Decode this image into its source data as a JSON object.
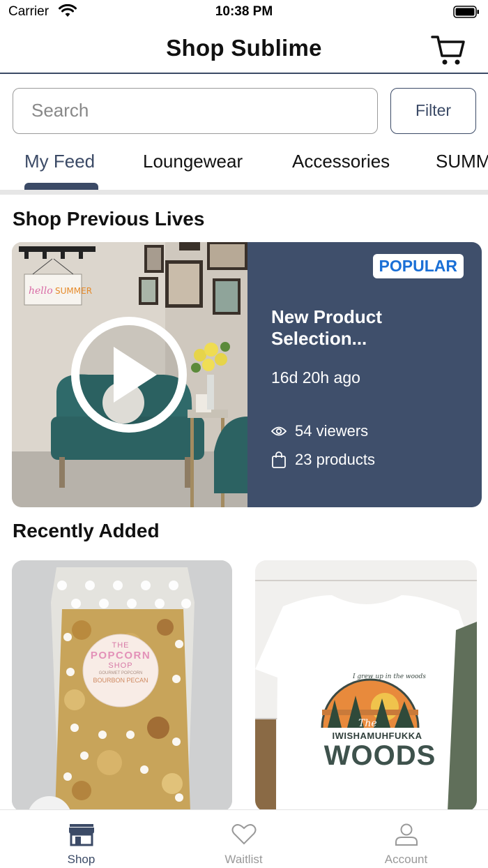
{
  "status_bar": {
    "carrier": "Carrier",
    "time": "10:38 PM"
  },
  "header": {
    "title": "Shop Sublime"
  },
  "search": {
    "placeholder": "Search",
    "filter_label": "Filter"
  },
  "tabs": [
    {
      "label": "My Feed",
      "active": true
    },
    {
      "label": "Loungewear",
      "active": false
    },
    {
      "label": "Accessories",
      "active": false
    },
    {
      "label": "SUMM",
      "active": false
    }
  ],
  "sections": {
    "previous_lives": "Shop Previous Lives",
    "recently_added": "Recently Added"
  },
  "live": {
    "badge": "POPULAR",
    "title": "New Product Selection...",
    "time_ago": "16d 20h ago",
    "viewers": "54 viewers",
    "products": "23 products"
  },
  "products": [
    {
      "label": "THE POPCORN SHOP",
      "sub": "BOURBON PECAN",
      "brand_top": "THE",
      "brand_mid": "POPCORN",
      "brand_bot": "SHOP",
      "tag": "GOURMET POPCORN"
    },
    {
      "label_top": "I grew up in the woods",
      "label_the": "The",
      "label_name": "IWISHAMUHFUKKA",
      "label_big": "WOODS"
    }
  ],
  "tab_bar": [
    {
      "label": "Shop",
      "icon": "store-icon",
      "active": true
    },
    {
      "label": "Waitlist",
      "icon": "heart-icon",
      "active": false
    },
    {
      "label": "Account",
      "icon": "person-icon",
      "active": false
    }
  ],
  "colors": {
    "accent": "#3b4a66",
    "badge_text": "#1a6fd6",
    "card_info": "#3f4f6b"
  }
}
